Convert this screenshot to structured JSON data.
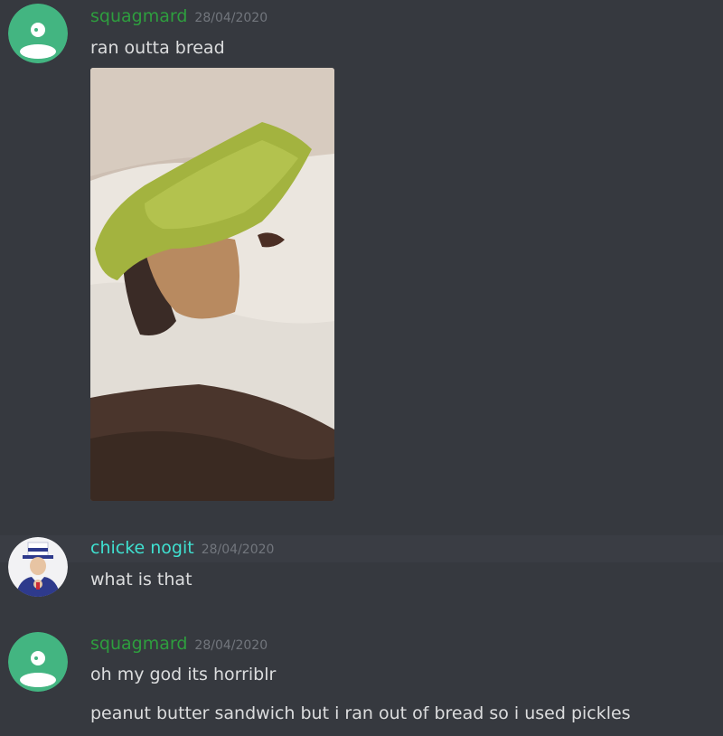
{
  "messages": [
    {
      "author": "squagmard",
      "timestamp": "28/04/2020",
      "lines": [
        "ran outta bread"
      ],
      "has_attachment": true,
      "author_color": "#2e9e3e"
    },
    {
      "author": "chicke nogit",
      "timestamp": "28/04/2020",
      "lines": [
        "what is that"
      ],
      "author_color": "#3fe0d0"
    },
    {
      "author": "squagmard",
      "timestamp": "28/04/2020",
      "lines": [
        "oh my god its horriblr",
        "peanut butter sandwich but i ran out of bread so i used pickles"
      ],
      "author_color": "#2e9e3e"
    }
  ],
  "colors": {
    "background": "#36393f",
    "text": "#dcddde",
    "timestamp": "#72767d",
    "avatar_green": "#43b581"
  },
  "icons": {
    "default_avatar": "discord-default-avatar-icon",
    "uncle_sam_avatar": "uncle-sam-avatar-icon"
  }
}
